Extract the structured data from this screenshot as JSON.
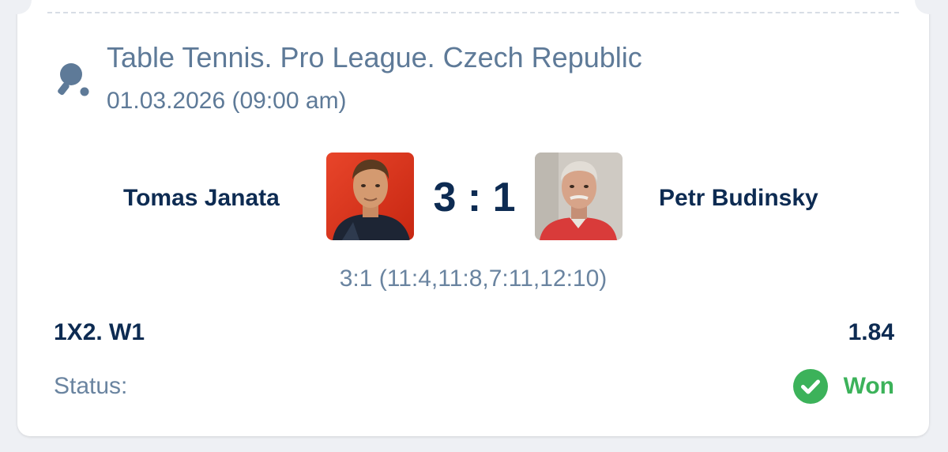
{
  "colors": {
    "primary_text": "#0d2b52",
    "secondary_text": "#5e7a98",
    "success": "#3cb25a",
    "background": "#eef0f4",
    "card": "#ffffff"
  },
  "event": {
    "sport_icon": "table-tennis-icon",
    "league": "Table Tennis. Pro League. Czech Republic",
    "date": "01.03.2026 (09:00 am)"
  },
  "match": {
    "home_player": "Tomas Janata",
    "away_player": "Petr Budinsky",
    "home_avatar": "player-photo",
    "away_avatar": "player-photo",
    "score": "3 : 1",
    "set_scores": "3:1 (11:4,11:8,7:11,12:10)"
  },
  "bet": {
    "market": "1X2. W1",
    "odds": "1.84",
    "status_label": "Status:",
    "status_icon": "check-circle-icon",
    "status_value": "Won"
  }
}
